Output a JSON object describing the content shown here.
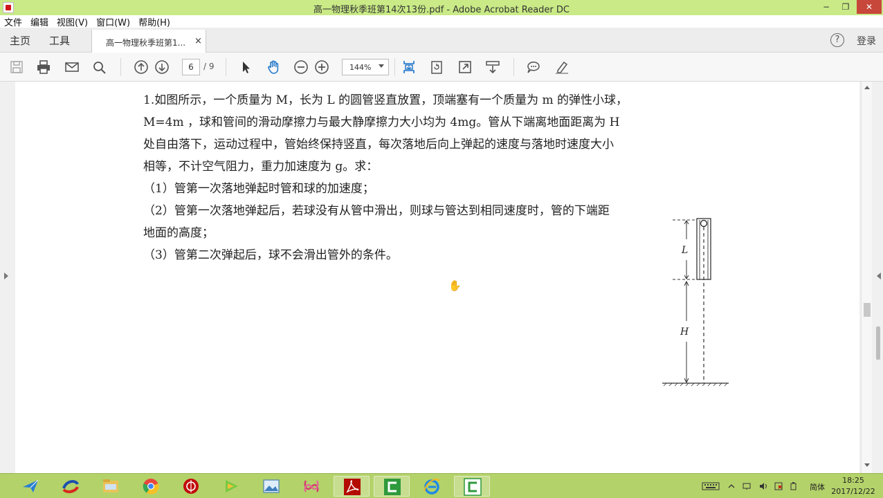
{
  "window": {
    "title": "高一物理秋季班第14次13份.pdf - Adobe Acrobat Reader DC",
    "min_label": "−",
    "max_label": "❐",
    "close_label": "✕"
  },
  "menu": [
    "文件",
    "编辑",
    "视图(V)",
    "窗口(W)",
    "帮助(H)"
  ],
  "tabs": {
    "home": "主页",
    "tools": "工具",
    "document": "高一物理秋季班第1...",
    "close": "×"
  },
  "header_right": {
    "help": "?",
    "login": "登录"
  },
  "toolbar": {
    "page_current": "6",
    "page_total": "/ 9",
    "zoom": "144%"
  },
  "document": {
    "lines": [
      "1.如图所示，一个质量为 M，长为 L 的圆管竖直放置，顶端塞有一个质量为 m 的弹性小球，",
      "M=4m ，球和管间的滑动摩擦力与最大静摩擦力大小均为 4mg。管从下端离地面距离为 H",
      "处自由落下，运动过程中，管始终保持竖直，每次落地后向上弹起的速度与落地时速度大小",
      "相等，不计空气阻力，重力加速度为 g。求：",
      "（1）管第一次落地弹起时管和球的加速度；",
      "（2）管第一次落地弹起后，若球没有从管中滑出，则球与管达到相同速度时，管的下端距",
      "地面的高度；",
      "（3）管第二次弹起后，球不会滑出管外的条件。"
    ],
    "figure": {
      "label_L": "L",
      "label_H": "H"
    }
  },
  "taskbar": {
    "apps": [
      "bird-icon",
      "ie-swirl-icon",
      "file-explorer-icon",
      "chrome-icon",
      "netease-music-icon",
      "media-player-icon",
      "photo-viewer-icon",
      "xmind-icon",
      "acrobat-icon",
      "camtasia-icon",
      "internet-explorer-icon",
      "camtasia-recorder-icon"
    ],
    "ime": "简体",
    "time": "18:25",
    "date": "2017/12/22"
  },
  "colors": {
    "titlebar": "#c9ea86",
    "taskbar": "#b4d26a",
    "close": "#c7473a",
    "accent_blue": "#1a73c9"
  }
}
